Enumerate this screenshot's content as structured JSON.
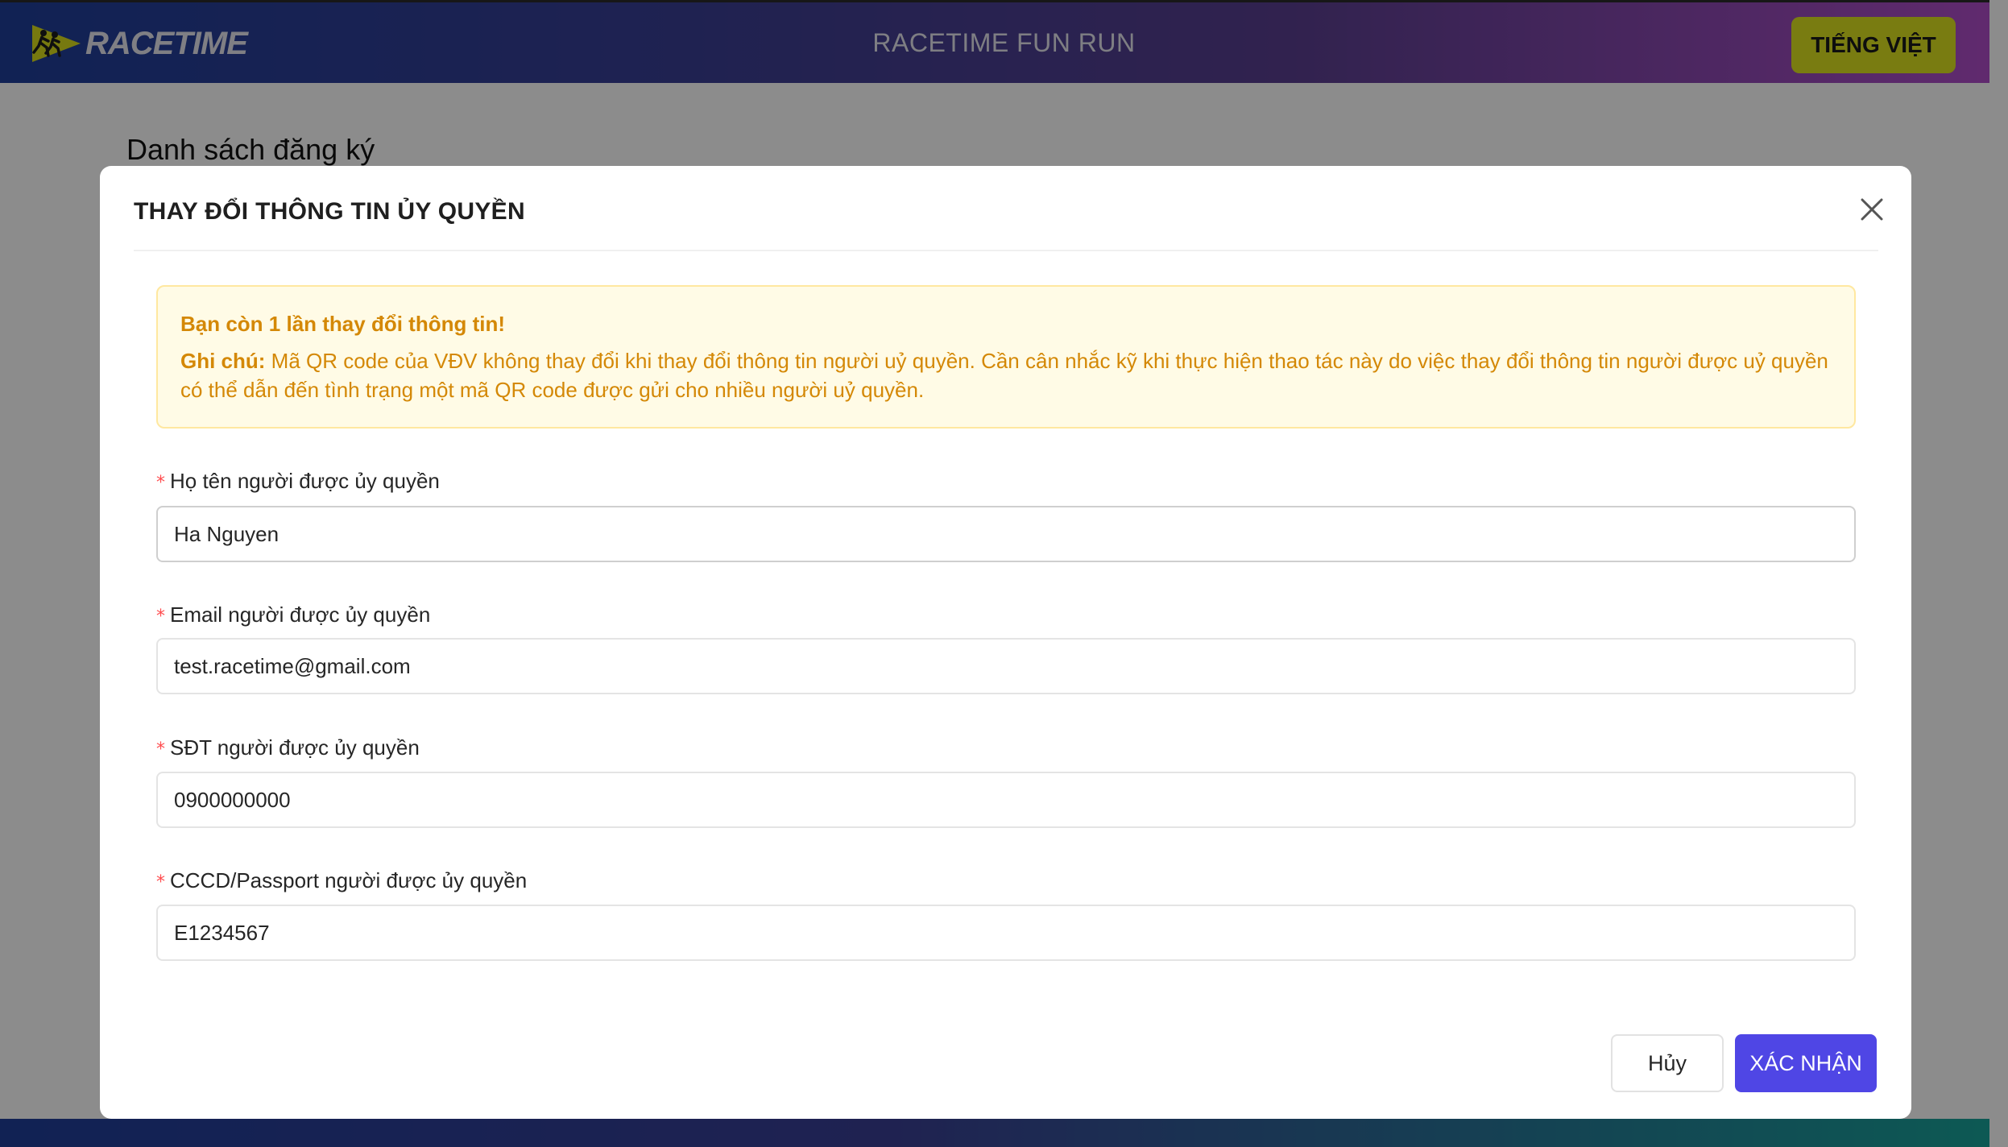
{
  "header": {
    "logo_text": "RACETIME",
    "title": "RACETIME FUN RUN",
    "language_button": "TIẾNG VIỆT"
  },
  "page": {
    "title": "Danh sách đăng ký"
  },
  "modal": {
    "title": "THAY ĐỔI THÔNG TIN ỦY QUYỀN",
    "alert": {
      "title": "Bạn còn 1 lần thay đổi thông tin!",
      "note_label": "Ghi chú:",
      "note_text": " Mã QR code của VĐV không thay đổi khi thay đổi thông tin người uỷ quyền. Cần cân nhắc kỹ khi thực hiện thao tác này do việc thay đổi thông tin người được uỷ quyền có thể dẫn đến tình trạng một mã QR code được gửi cho nhiều người uỷ quyền."
    },
    "fields": [
      {
        "label": "Họ tên người được ủy quyền",
        "value": "Ha Nguyen"
      },
      {
        "label": "Email người được ủy quyền",
        "value": "test.racetime@gmail.com"
      },
      {
        "label": "SĐT người được ủy quyền",
        "value": "0900000000"
      },
      {
        "label": "CCCD/Passport người được ủy quyền",
        "value": "E1234567"
      }
    ],
    "cancel_label": "Hủy",
    "confirm_label": "XÁC NHẬN"
  },
  "colors": {
    "primary": "#4f46e5",
    "language_button": "#dde21f",
    "alert_text": "#d48806",
    "alert_bg": "#fffbe6",
    "required": "#ff4d4f"
  }
}
